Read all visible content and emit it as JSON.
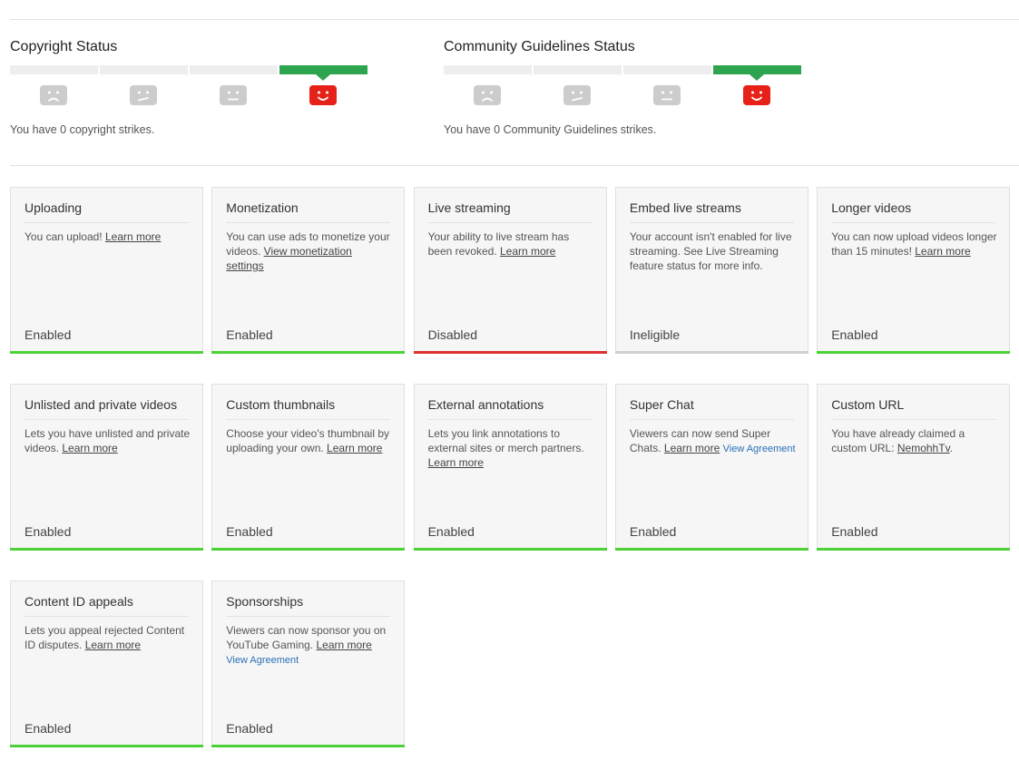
{
  "copyright": {
    "title": "Copyright Status",
    "description": "You have 0 copyright strikes.",
    "strikes": 0,
    "faces": [
      "sad-face-icon",
      "meh-face-icon",
      "neutral-face-icon",
      "happy-face-icon"
    ],
    "active_color": "#2ea44f"
  },
  "community": {
    "title": "Community Guidelines Status",
    "description": "You have 0 Community Guidelines strikes.",
    "strikes": 0,
    "faces": [
      "sad-face-icon",
      "meh-face-icon",
      "neutral-face-icon",
      "happy-face-icon"
    ],
    "active_color": "#2ea44f"
  },
  "colors": {
    "enabled": "#4cd137",
    "disabled": "#e03131",
    "ineligible": "#cfcfcf",
    "link_blue": "#2a70b8",
    "face_gray": "#cccccc",
    "face_red": "#e62117"
  },
  "features": [
    {
      "title": "Uploading",
      "text": "You can upload! ",
      "link": "Learn more",
      "status": "Enabled"
    },
    {
      "title": "Monetization",
      "text": "You can use ads to monetize your videos. ",
      "link": "View monetization settings",
      "status": "Enabled"
    },
    {
      "title": "Live streaming",
      "text": "Your ability to live stream has been revoked. ",
      "link": "Learn more",
      "status": "Disabled"
    },
    {
      "title": "Embed live streams",
      "text": "Your account isn't enabled for live streaming. See Live Streaming feature status for more info.",
      "status": "Ineligible"
    },
    {
      "title": "Longer videos",
      "text": "You can now upload videos longer than 15 minutes! ",
      "link": "Learn more",
      "status": "Enabled"
    },
    {
      "title": "Unlisted and private videos",
      "text": "Lets you have unlisted and private videos. ",
      "link": "Learn more",
      "status": "Enabled"
    },
    {
      "title": "Custom thumbnails",
      "text": "Choose your video's thumbnail by uploading your own. ",
      "link": "Learn more",
      "status": "Enabled"
    },
    {
      "title": "External annotations",
      "text": "Lets you link annotations to external sites or merch partners. ",
      "link": "Learn more",
      "status": "Enabled"
    },
    {
      "title": "Super Chat",
      "text": "Viewers can now send Super Chats. ",
      "link": "Learn more",
      "link2": "View Agreement",
      "status": "Enabled"
    },
    {
      "title": "Custom URL",
      "text": "You have already claimed a custom URL: ",
      "link": "NemohhTv",
      "suffix": ".",
      "status": "Enabled"
    },
    {
      "title": "Content ID appeals",
      "text": "Lets you appeal rejected Content ID disputes. ",
      "link": "Learn more",
      "status": "Enabled"
    },
    {
      "title": "Sponsorships",
      "text": "Viewers can now sponsor you on YouTube Gaming. ",
      "link": "Learn more",
      "link2": "View Agreement",
      "link2_block": true,
      "status": "Enabled"
    }
  ]
}
